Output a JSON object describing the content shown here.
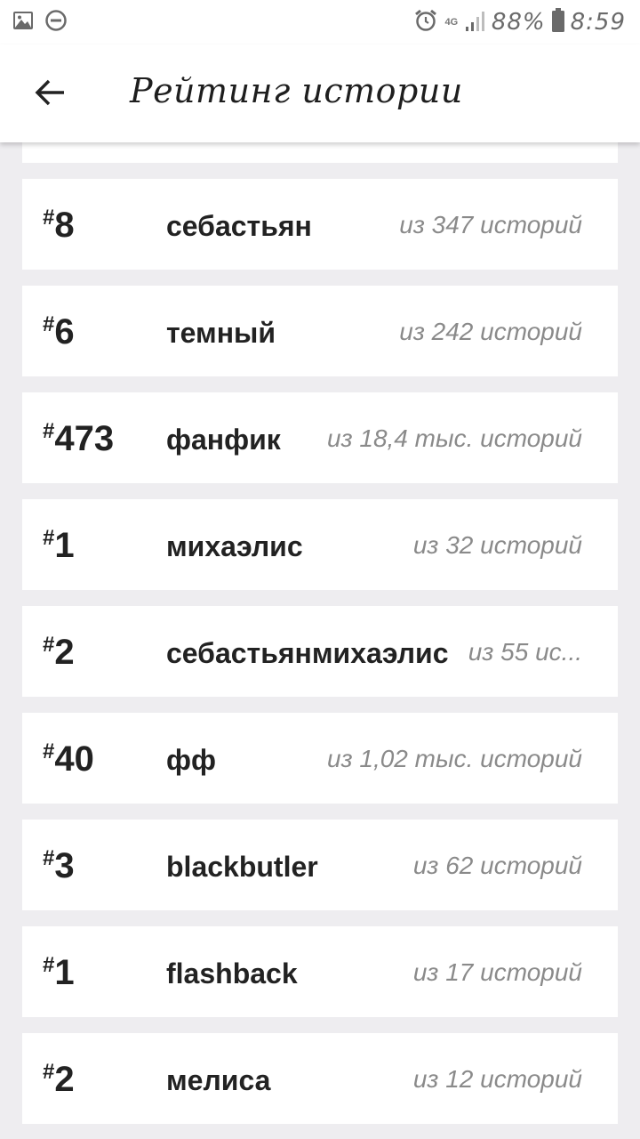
{
  "status_bar": {
    "network": "4G",
    "battery": "88%",
    "time": "8:59",
    "icons": [
      "image-icon",
      "dnd-icon",
      "alarm-icon",
      "signal-icon",
      "battery-icon"
    ]
  },
  "header": {
    "title": "Рейтинг истории",
    "back_icon": "arrow-left-icon"
  },
  "rankings": [
    {
      "hash": "#",
      "rank": "8",
      "tag": "себастьян",
      "count": "из 347 историй"
    },
    {
      "hash": "#",
      "rank": "6",
      "tag": "темный",
      "count": "из 242 историй"
    },
    {
      "hash": "#",
      "rank": "473",
      "tag": "фанфик",
      "count": "из 18,4 тыс. историй"
    },
    {
      "hash": "#",
      "rank": "1",
      "tag": "михаэлис",
      "count": "из 32 историй"
    },
    {
      "hash": "#",
      "rank": "2",
      "tag": "себастьянмихаэлис",
      "count": "из 55 ис..."
    },
    {
      "hash": "#",
      "rank": "40",
      "tag": "фф",
      "count": "из 1,02 тыс. историй"
    },
    {
      "hash": "#",
      "rank": "3",
      "tag": "blackbutler",
      "count": "из 62 историй"
    },
    {
      "hash": "#",
      "rank": "1",
      "tag": "flashback",
      "count": "из 17 историй"
    },
    {
      "hash": "#",
      "rank": "2",
      "tag": "мелиса",
      "count": "из 12 историй"
    }
  ]
}
